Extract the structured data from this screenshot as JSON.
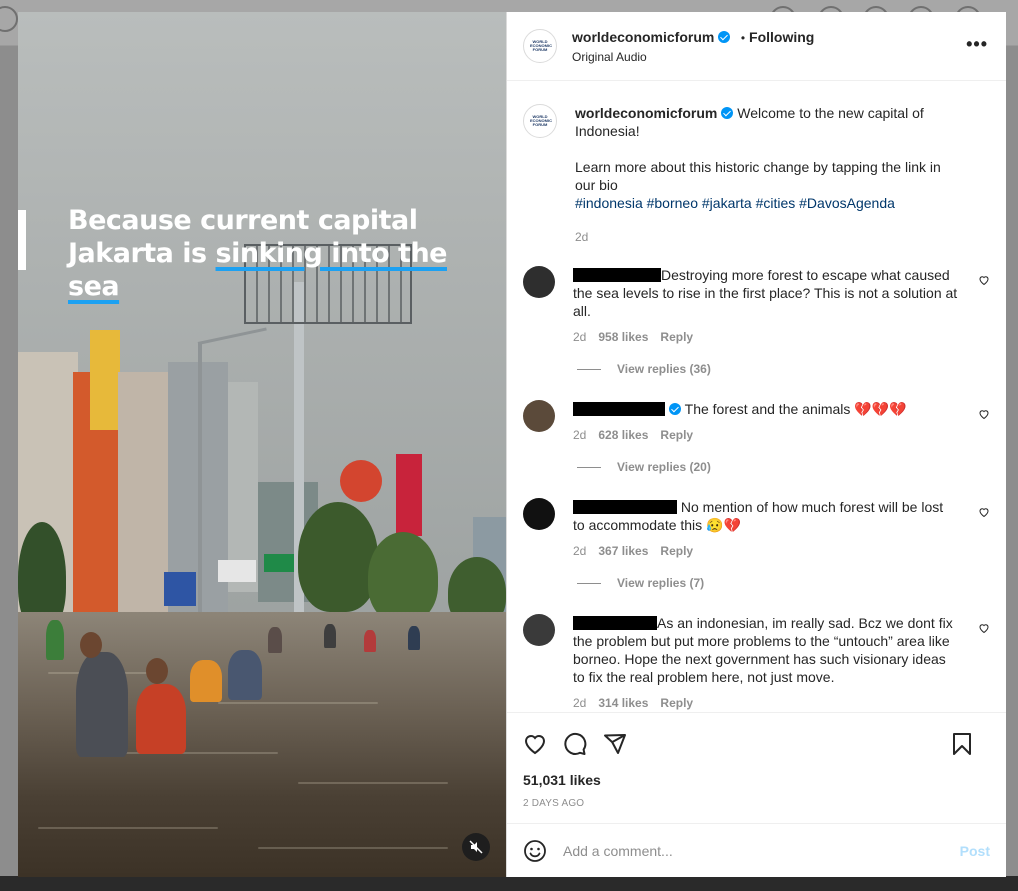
{
  "overlay": {
    "line1": "Because current capital",
    "line2_plain": "Jakarta is ",
    "line2_highlight": "sinking into the sea"
  },
  "header": {
    "avatar_text": "WORLD ECONOMIC FORUM",
    "username": "worldeconomicforum",
    "separator": "•",
    "following": "Following",
    "audio": "Original Audio",
    "more": "•••"
  },
  "caption": {
    "username": "worldeconomicforum",
    "text": "Welcome to the new capital of Indonesia!",
    "learn_more": "Learn more about this historic change by tapping the link in our bio",
    "hashtags": "#indonesia #borneo #jakarta #cities #DavosAgenda",
    "time": "2d"
  },
  "comments": [
    {
      "username_visible": "",
      "text": "Destroying more forest to escape what caused the sea levels to rise in the first place? This is not a solution at all.",
      "time": "2d",
      "likes": "958 likes",
      "reply": "Reply",
      "view_replies": "View replies (36)"
    },
    {
      "username_visible": "",
      "text": "The forest and the animals",
      "emoji": "💔💔💔",
      "time": "2d",
      "likes": "628 likes",
      "reply": "Reply",
      "view_replies": "View replies (20)"
    },
    {
      "username_visible": "",
      "text": "No mention of how much forest will be lost to accommodate this",
      "emoji": "😥💔",
      "time": "2d",
      "likes": "367 likes",
      "reply": "Reply",
      "view_replies": "View replies (7)"
    },
    {
      "username_visible": "",
      "text": "As an indonesian, im really sad. Bcz we dont fix the problem but put more problems to the “untouch” area like borneo. Hope the next government has such visionary ideas to fix the real problem here, not just move.",
      "time": "2d",
      "likes": "314 likes",
      "reply": "Reply"
    }
  ],
  "likes": "51,031 likes",
  "time_ago": "2 DAYS AGO",
  "composer": {
    "placeholder": "Add a comment...",
    "post": "Post"
  },
  "icons": [
    "heart-icon",
    "comment-icon",
    "share-icon",
    "bookmark-icon",
    "emoji-icon",
    "mute-icon",
    "more-icon",
    "verified-icon"
  ],
  "colors": {
    "accent": "#0095f6",
    "post_disabled": "#b2dffc",
    "hashtag": "#00376b",
    "muted": "#8e8e8e"
  }
}
